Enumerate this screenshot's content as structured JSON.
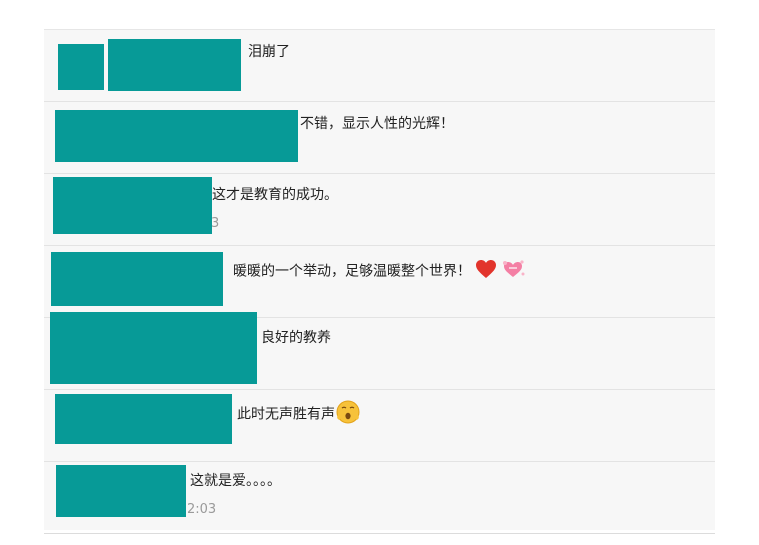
{
  "comments": [
    {
      "text": "泪崩了",
      "meta": ""
    },
    {
      "text": "不错，显示人性的光辉！",
      "meta": ""
    },
    {
      "text": "这才是教育的成功。",
      "meta": "3"
    },
    {
      "text": "暖暖的一个举动，足够温暖整个世界！",
      "meta": "",
      "emojis": [
        "heart-icon",
        "heart-burst-icon"
      ]
    },
    {
      "text": "良好的教养",
      "meta": ""
    },
    {
      "text": "此时无声胜有声",
      "meta": "",
      "emojis": [
        "hushed-face-icon"
      ]
    },
    {
      "text": "这就是爱。。。。",
      "meta": "2:03"
    }
  ],
  "colors": {
    "redaction": "#079a97",
    "panel": "#f7f7f7",
    "divider": "#e3e3e3"
  }
}
